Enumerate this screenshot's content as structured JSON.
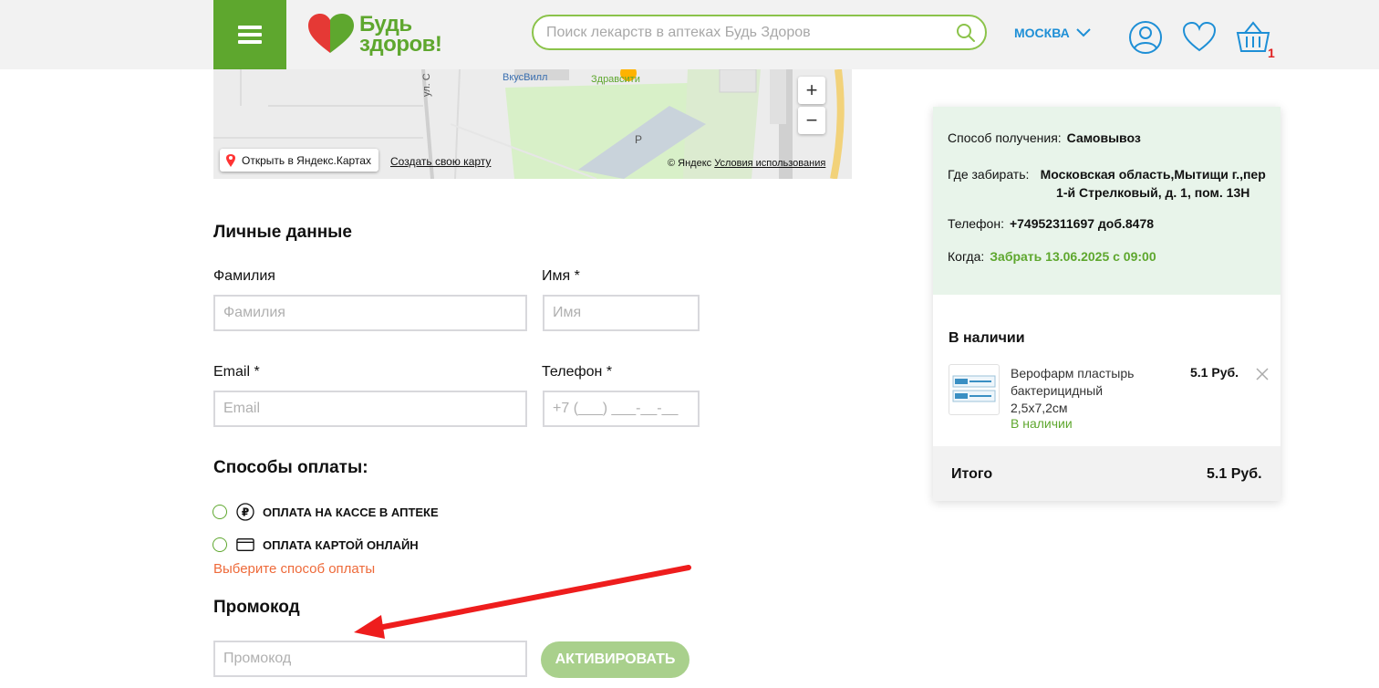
{
  "header": {
    "menu_icon": "hamburger-icon",
    "logo_line1": "Будь",
    "logo_line2": "здоров!",
    "search_placeholder": "Поиск лекарств в аптеках Будь Здоров",
    "city": "МОСКВА",
    "cart_count": "1",
    "brand_green": "#5ea72e",
    "accent_blue": "#1e8fd6"
  },
  "map": {
    "place_labels": [
      "ВкусВилл",
      "Здравсити",
      "ул. С",
      "Р"
    ],
    "open_link": "Открыть в Яндекс.Картах",
    "create_link": "Создать свою карту",
    "copyright": "© Яндекс",
    "terms_link": "Условия использования",
    "zoom_in": "+",
    "zoom_out": "−"
  },
  "personal": {
    "title": "Личные данные",
    "lastname_label": "Фамилия",
    "lastname_placeholder": "Фамилия",
    "firstname_label": "Имя *",
    "firstname_placeholder": "Имя",
    "email_label": "Email *",
    "email_placeholder": "Email",
    "phone_label": "Телефон *",
    "phone_placeholder": "+7 (___) ___-__-__"
  },
  "payment": {
    "title": "Способы оплаты:",
    "options": [
      {
        "label": "ОПЛАТА НА КАССЕ В АПТЕКЕ",
        "icon": "ruble-icon"
      },
      {
        "label": "ОПЛАТА КАРТОЙ ОНЛАЙН",
        "icon": "card-icon"
      }
    ],
    "error": "Выберите способ оплаты",
    "error_color": "#ee6a3a"
  },
  "promo": {
    "title": "Промокод",
    "placeholder": "Промокод",
    "button": "АКТИВИРОВАТЬ"
  },
  "summary": {
    "method_label": "Способ получения:",
    "method_value": "Самовывоз",
    "pickup_label": "Где забирать:",
    "pickup_value": "Московская область,Мытищи г.,пер 1-й Стрелковый, д. 1, пом. 13Н",
    "phone_label": "Телефон:",
    "phone_value": "+74952311697 доб.8478",
    "when_label": "Когда:",
    "when_value": "Забрать 13.06.2025 с 09:00",
    "stock_title": "В наличии",
    "product_name": "Верофарм пластырь бактерицидный 2,5х7,2см",
    "product_status": "В наличии",
    "product_price": "5.1 Руб.",
    "total_label": "Итого",
    "total_value": "5.1 Руб."
  }
}
